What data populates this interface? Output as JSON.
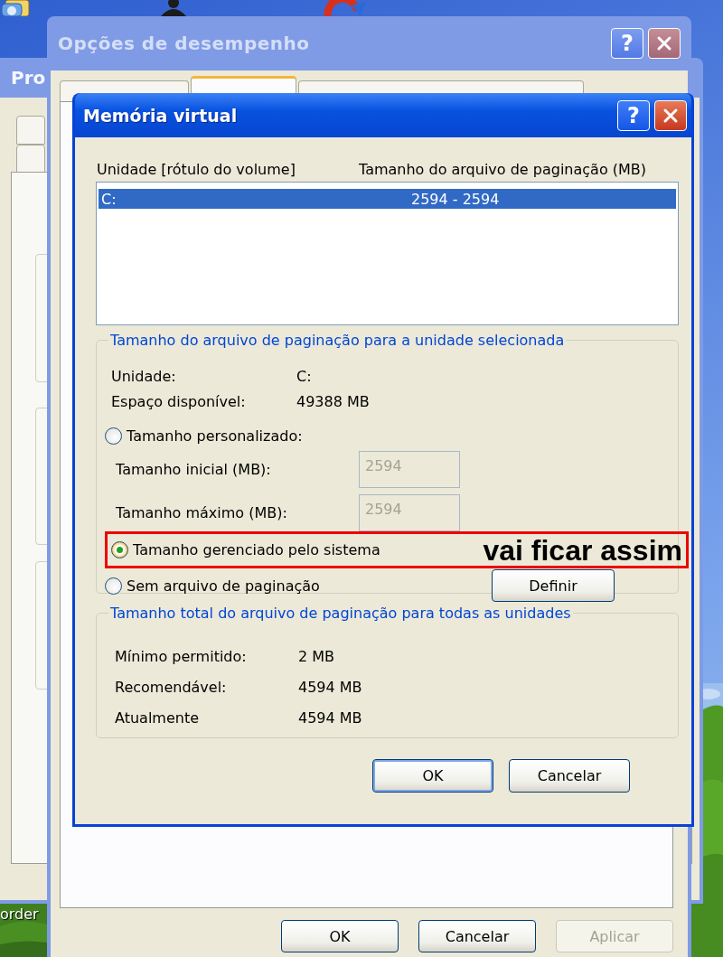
{
  "desktop": {
    "icon_label": "order"
  },
  "back_window": {
    "title": "Pro",
    "active": false
  },
  "performance_window": {
    "title": "Opções de desempenho",
    "active": false,
    "title_buttons": [
      {
        "kind": "help",
        "glyph": "?"
      },
      {
        "kind": "close"
      }
    ],
    "tabs": [
      {
        "selected": false
      },
      {
        "selected": true
      },
      {
        "selected": false
      }
    ],
    "buttons": [
      {
        "label": "OK",
        "disabled": false
      },
      {
        "label": "Cancelar",
        "disabled": false
      },
      {
        "label": "Aplicar",
        "disabled": true
      }
    ]
  },
  "dialog": {
    "title": "Memória virtual",
    "active": true,
    "title_buttons": [
      {
        "kind": "help",
        "glyph": "?"
      },
      {
        "kind": "close"
      }
    ],
    "list": {
      "columns": [
        "Unidade [rótulo do volume]",
        "Tamanho do arquivo de paginação (MB)"
      ],
      "rows": [
        {
          "drive": "C:",
          "size": "2594 - 2594",
          "selected": true
        }
      ]
    },
    "drive_group": {
      "legend": "Tamanho do arquivo de paginação para a unidade selecionada",
      "info": [
        {
          "label": "Unidade:",
          "value": "C:"
        },
        {
          "label": "Espaço disponível:",
          "value": "49388 MB"
        }
      ],
      "custom_option": {
        "label": "Tamanho personalizado:",
        "selected": false
      },
      "fields": [
        {
          "label": "Tamanho inicial (MB):",
          "value": "2594",
          "disabled": true
        },
        {
          "label": "Tamanho máximo (MB):",
          "value": "2594",
          "disabled": true
        }
      ],
      "system_option": {
        "label": "Tamanho gerenciado pelo sistema",
        "selected": true
      },
      "none_option": {
        "label": "Sem arquivo de paginação",
        "selected": false
      },
      "set_button": "Definir"
    },
    "total_group": {
      "legend": "Tamanho total do arquivo de paginação para todas as unidades",
      "rows": [
        {
          "label": "Mínimo permitido:",
          "value": "2 MB"
        },
        {
          "label": "Recomendável:",
          "value": "4594 MB"
        },
        {
          "label": "Atualmente",
          "value": "4594 MB"
        }
      ]
    },
    "buttons": [
      {
        "label": "OK",
        "default": true
      },
      {
        "label": "Cancelar",
        "default": false
      }
    ]
  },
  "annotation": {
    "text": "vai ficar assim"
  }
}
